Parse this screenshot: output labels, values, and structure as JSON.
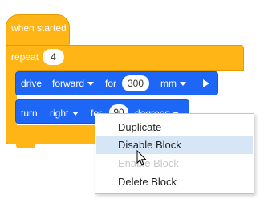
{
  "hat": {
    "label": "when started"
  },
  "repeat": {
    "label": "repeat",
    "count": "4"
  },
  "drive_block": {
    "label": "drive",
    "direction": "forward",
    "for_label": "for",
    "distance": "300",
    "unit": "mm"
  },
  "turn_block": {
    "label": "turn",
    "direction": "right",
    "for_label": "for",
    "angle": "90",
    "unit": "degrees"
  },
  "context_menu": {
    "items": [
      {
        "label": "Duplicate",
        "state": "normal"
      },
      {
        "label": "Disable Block",
        "state": "hover"
      },
      {
        "label": "Enable Block",
        "state": "disabled"
      },
      {
        "label": "Delete Block",
        "state": "normal"
      }
    ]
  },
  "colors": {
    "events_block": "#ffb515",
    "motion_block": "#1e66f5",
    "menu_hover": "#d6e6f6"
  }
}
